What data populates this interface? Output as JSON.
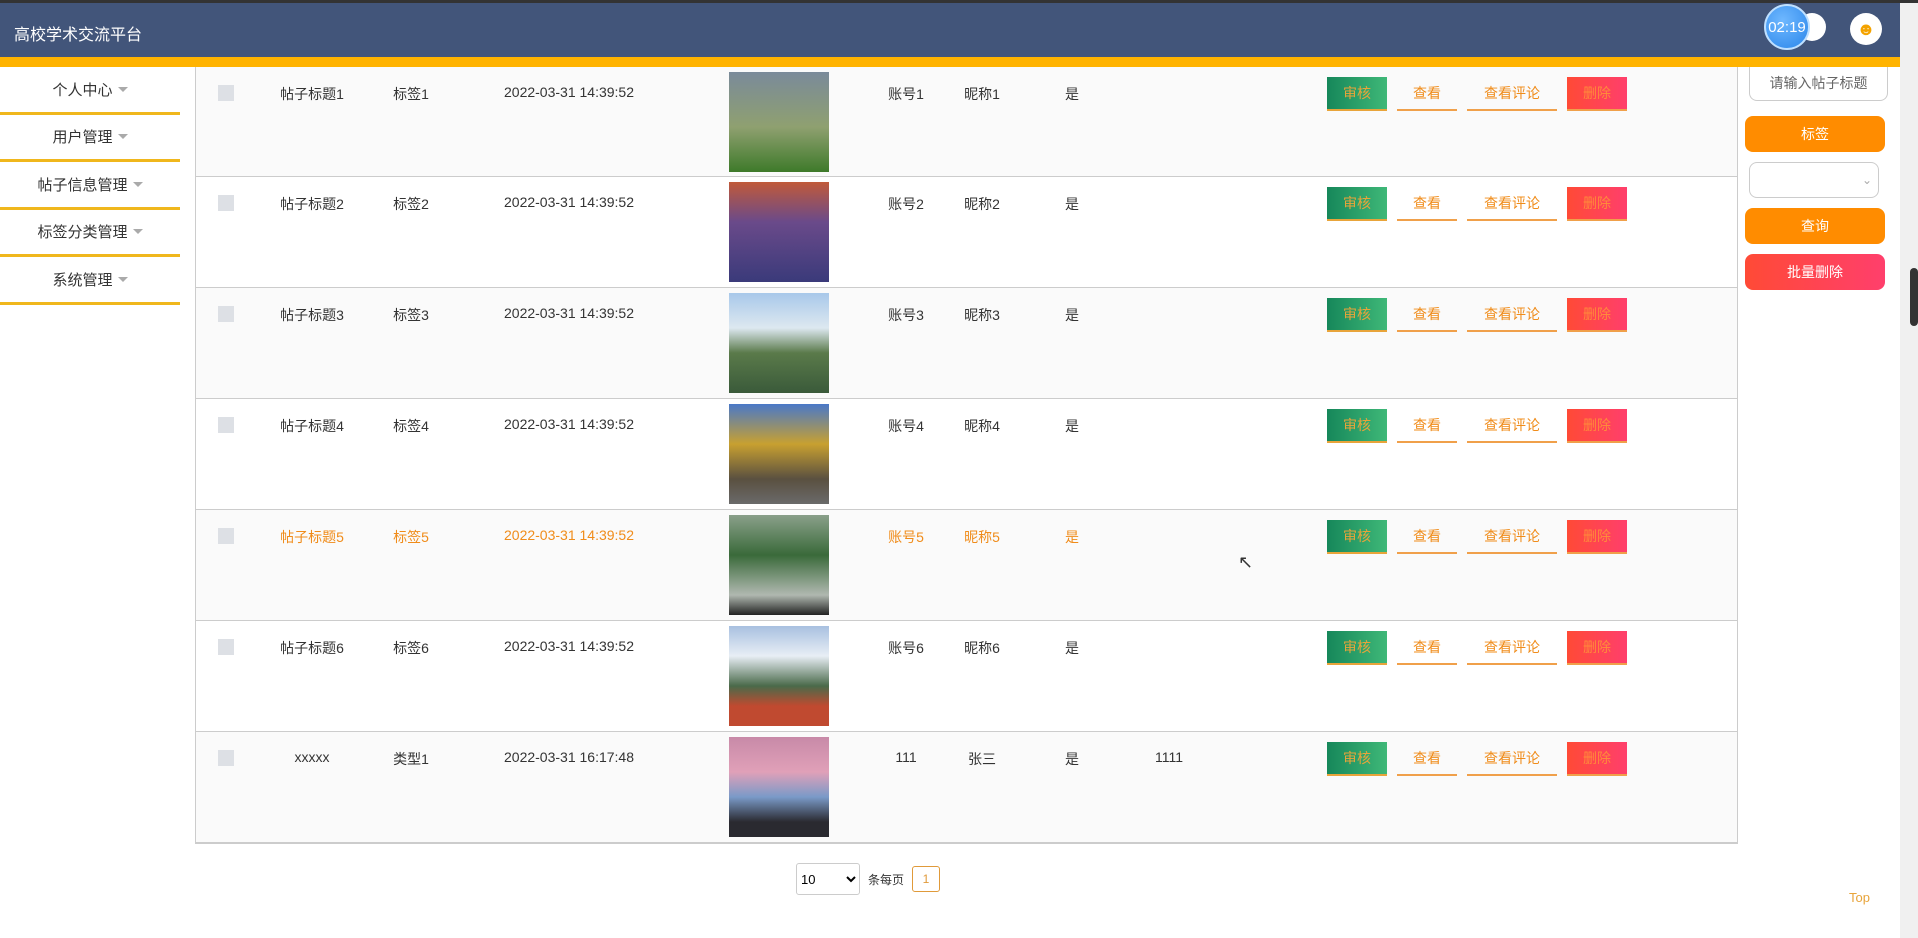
{
  "header": {
    "title": "高校学术交流平台",
    "timer": "02:19"
  },
  "sidebar": {
    "items": [
      {
        "label": "个人中心"
      },
      {
        "label": "用户管理"
      },
      {
        "label": "帖子信息管理"
      },
      {
        "label": "标签分类管理"
      },
      {
        "label": "系统管理"
      }
    ]
  },
  "rows": [
    {
      "title": "帖子标题1",
      "tag": "标签1",
      "time": "2022-03-31 14:39:52",
      "account": "账号1",
      "nickname": "昵称1",
      "flag": "是",
      "extra": "",
      "img": "linear-gradient(#7a8a9a,#8fa070 55%,#3e7a2a)"
    },
    {
      "title": "帖子标题2",
      "tag": "标签2",
      "time": "2022-03-31 14:39:52",
      "account": "账号2",
      "nickname": "昵称2",
      "flag": "是",
      "extra": "",
      "img": "linear-gradient(#c05a3a,#6a4a8a 40%,#3a3a7a)"
    },
    {
      "title": "帖子标题3",
      "tag": "标签3",
      "time": "2022-03-31 14:39:52",
      "account": "账号3",
      "nickname": "昵称3",
      "flag": "是",
      "extra": "",
      "img": "linear-gradient(#a8c8ea,#dde8f0 35%,#5a7a4a 60%,#3a5a3a)"
    },
    {
      "title": "帖子标题4",
      "tag": "标签4",
      "time": "2022-03-31 14:39:52",
      "account": "账号4",
      "nickname": "昵称4",
      "flag": "是",
      "extra": "",
      "img": "linear-gradient(#4a78c8,#c8a030 40%,#5a5040 75%,#6a6a6a)"
    },
    {
      "title": "帖子标题5",
      "tag": "标签5",
      "time": "2022-03-31 14:39:52",
      "account": "账号5",
      "nickname": "昵称5",
      "flag": "是",
      "extra": "",
      "img": "linear-gradient(#8aa08a,#3a6a3a 40%,#b0b8b0 80%,#222)"
    },
    {
      "title": "帖子标题6",
      "tag": "标签6",
      "time": "2022-03-31 14:39:52",
      "account": "账号6",
      "nickname": "昵称6",
      "flag": "是",
      "extra": "",
      "img": "linear-gradient(#a8c0e0,#e8eef5 30%,#4a6a4a 60%,#c04a30 80%)"
    },
    {
      "title": "xxxxx",
      "tag": "类型1",
      "time": "2022-03-31 16:17:48",
      "account": "111",
      "nickname": "张三",
      "flag": "是",
      "extra": "1111",
      "img": "linear-gradient(#c88aa8,#e0a0b8 35%,#7a9ac8 60%,#2a2a30 85%)"
    }
  ],
  "actions": {
    "audit": "审核",
    "view": "查看",
    "comments": "查看评论",
    "delete": "删除"
  },
  "right": {
    "search_placeholder": "请输入帖子标题",
    "tag_btn": "标签",
    "select_value": "",
    "query_btn": "查询",
    "batch_delete": "批量删除"
  },
  "pager": {
    "per_page": "10",
    "per_page_label": "条每页",
    "page": "1"
  },
  "top": "Top",
  "colors": {
    "header": "#42557a",
    "accent": "#ffb300",
    "orange": "#ff8c00"
  }
}
